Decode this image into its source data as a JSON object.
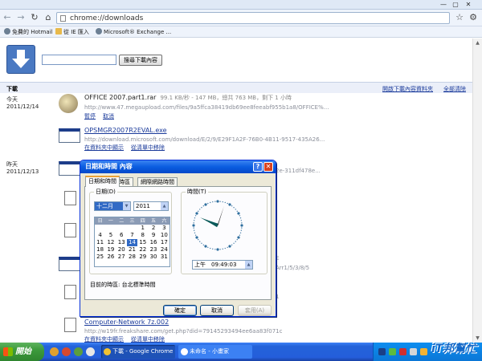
{
  "browser": {
    "url": "chrome://downloads",
    "bookmarks": [
      "免費的 Hotmail",
      "從 IE 匯入",
      "Microsoft® Exchange ..."
    ]
  },
  "downloads_page": {
    "search_button": "搜尋下載內容",
    "section_title": "下載",
    "links": [
      "開啟下載內容資料夾",
      "全部清除"
    ],
    "groups": [
      {
        "day": "今天",
        "date": "2011/12/14"
      },
      {
        "day": "昨天",
        "date": "2011/12/13"
      }
    ],
    "items": [
      {
        "title": "OFFICE 2007.part1.rar",
        "size": "99.1 KB/秒 - 147 MB，總共 763 MB，剩下 1 小時",
        "url": "http://www.47.megaupload.com/files/9a5ffca38419db69ee8feeabf955b1a8/OFFICE%...",
        "actions": [
          "暫停",
          "取消"
        ]
      },
      {
        "title": "OPSMGR2007R2EVAL.exe",
        "url": "http://download.microsoft.com/download/E/2/9/E29F1A2F-76B0-4B11-9517-435A26...",
        "actions": [
          "在資料夾中顯示",
          "從清單中移除"
        ]
      },
      {
        "title": "Computer-Network 7z.002",
        "url": "http://w19fr.freakshare.com/get.php?did=79145293494ee6aa83f071c",
        "actions": [
          "在資料夾中顯示",
          "從清單中移除"
        ]
      }
    ],
    "partial_texts": [
      "2e-311df478e...",
      "E",
      "Arr1/5/3/8/5",
      "1"
    ]
  },
  "dialog": {
    "title": "日期和時間 內容",
    "tabs": [
      "日期和時間",
      "時區",
      "網際網路時間"
    ],
    "date_group": "日期(D)",
    "month": "十二月",
    "year": "2011",
    "weekdays": [
      "日",
      "一",
      "二",
      "三",
      "四",
      "五",
      "六"
    ],
    "days": [
      "",
      "",
      "",
      "",
      "1",
      "2",
      "3",
      "4",
      "5",
      "6",
      "7",
      "8",
      "9",
      "10",
      "11",
      "12",
      "13",
      "14",
      "15",
      "16",
      "17",
      "18",
      "19",
      "20",
      "21",
      "22",
      "23",
      "24",
      "25",
      "26",
      "27",
      "28",
      "29",
      "30",
      "31"
    ],
    "selected_day": "14",
    "time_group": "時間(T)",
    "time_value": "上午　09:49:03",
    "clock": {
      "hour": 9,
      "minute": 49,
      "second": 3
    },
    "timezone": "目前的時區: 台北標準時間",
    "buttons": {
      "ok": "確定",
      "cancel": "取消",
      "apply": "套用(A)"
    }
  },
  "taskbar": {
    "start": "開始",
    "tasks": [
      "下載 - Google Chrome",
      "未命名 - 小畫家"
    ]
  },
  "watermark": "iT邦幫忙",
  "colors": {
    "accent": "#316ac5",
    "xp_title": "#0a5de0",
    "link": "#1a3a9a"
  }
}
